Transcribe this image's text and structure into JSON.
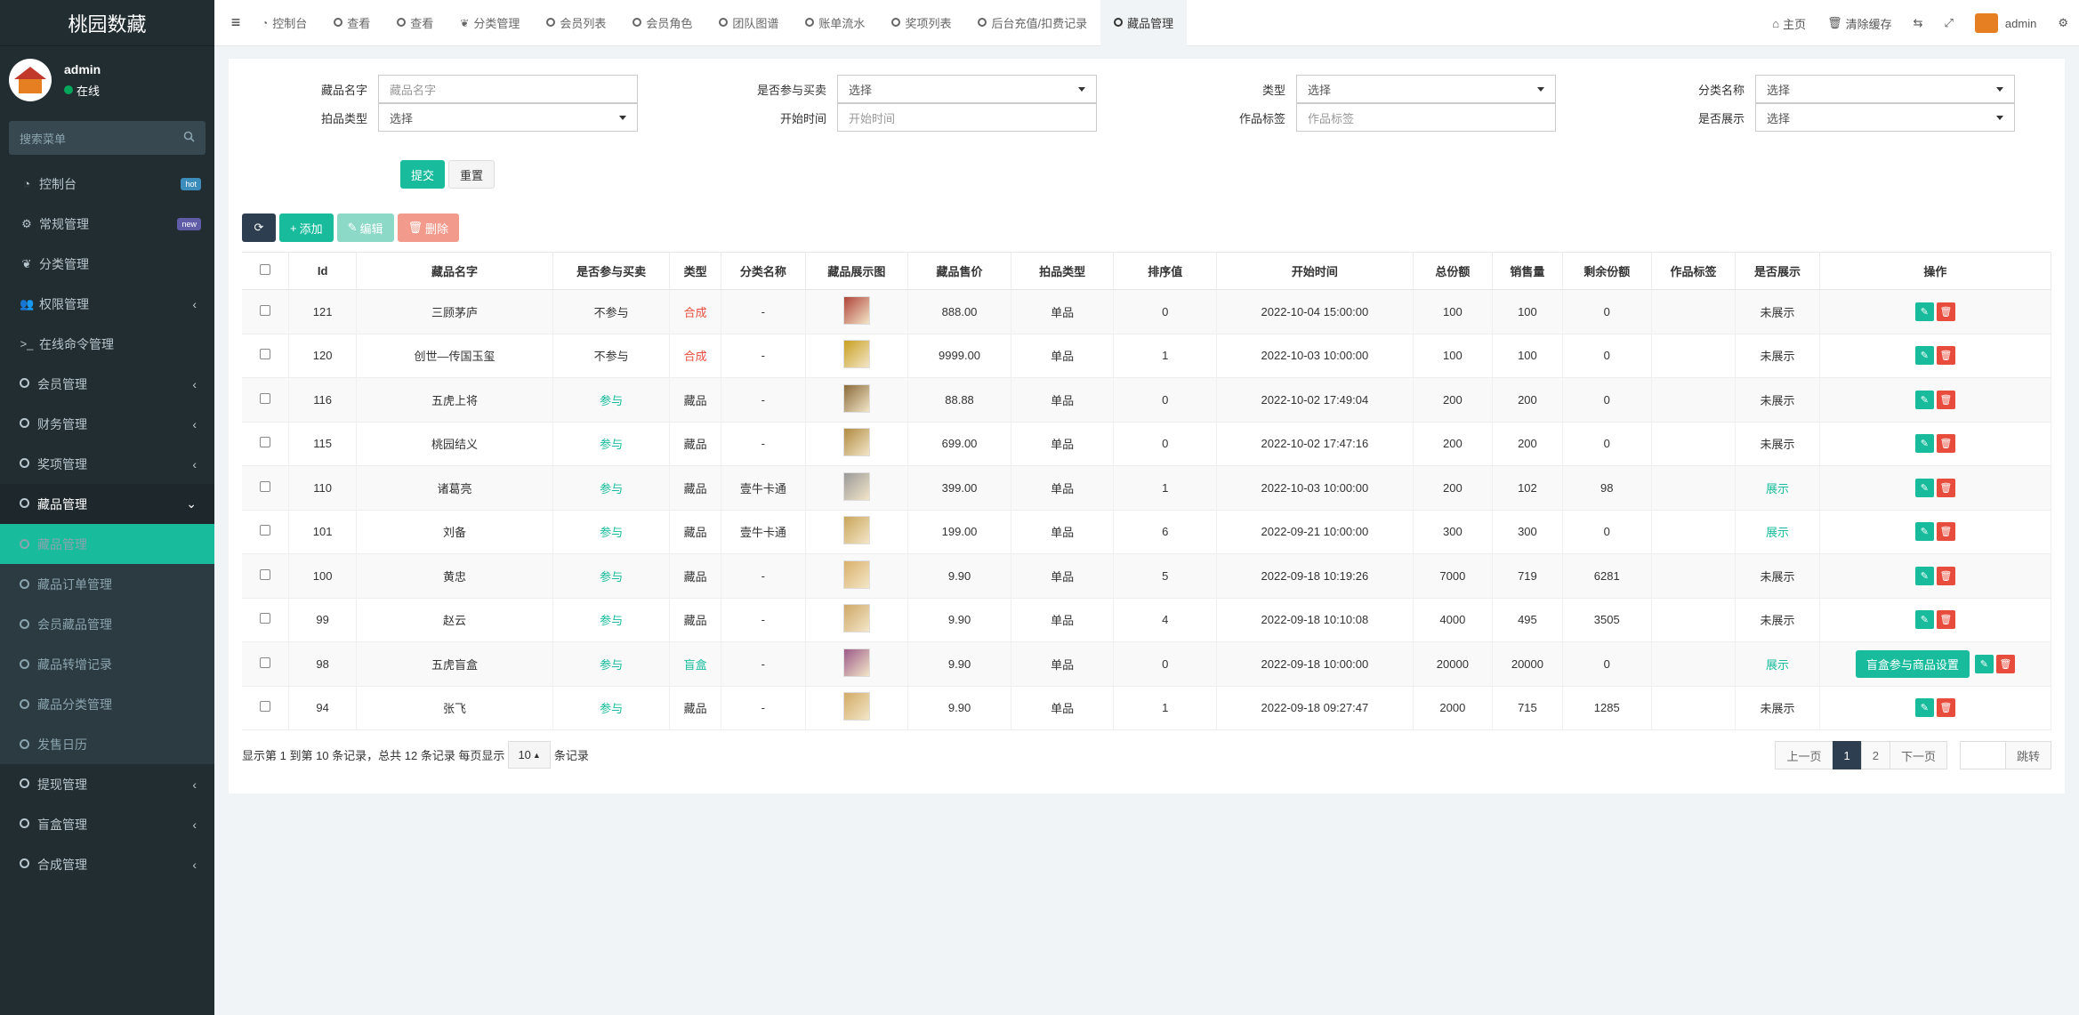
{
  "sidebar": {
    "brand": "桃园数藏",
    "user": {
      "name": "admin",
      "status": "在线"
    },
    "search_placeholder": "搜索菜单",
    "items": [
      {
        "label": "控制台",
        "icon": "dashboard-icon",
        "badge": "hot",
        "badge_color": "#3c8dbc"
      },
      {
        "label": "常规管理",
        "icon": "cogs-icon",
        "badge": "new",
        "badge_color": "#605ca8"
      },
      {
        "label": "分类管理",
        "icon": "leaf-icon"
      },
      {
        "label": "权限管理",
        "icon": "group-icon",
        "arrow": "‹"
      },
      {
        "label": "在线命令管理",
        "icon": "terminal-icon"
      },
      {
        "label": "会员管理",
        "icon": "circle-icon",
        "arrow": "‹"
      },
      {
        "label": "财务管理",
        "icon": "circle-icon",
        "arrow": "‹"
      },
      {
        "label": "奖项管理",
        "icon": "circle-icon",
        "arrow": "‹"
      },
      {
        "label": "藏品管理",
        "icon": "circle-icon",
        "arrow": "⌄"
      }
    ],
    "sub_items": [
      {
        "label": "藏品管理",
        "active": true
      },
      {
        "label": "藏品订单管理"
      },
      {
        "label": "会员藏品管理"
      },
      {
        "label": "藏品转增记录"
      },
      {
        "label": "藏品分类管理"
      },
      {
        "label": "发售日历"
      }
    ],
    "bottom_items": [
      {
        "label": "提现管理",
        "arrow": "‹"
      },
      {
        "label": "盲盒管理",
        "arrow": "‹"
      },
      {
        "label": "合成管理",
        "arrow": "‹"
      }
    ]
  },
  "tabs": [
    {
      "label": "控制台",
      "icon": "dashboard-icon"
    },
    {
      "label": "查看",
      "icon": "circle-icon"
    },
    {
      "label": "查看",
      "icon": "circle-icon"
    },
    {
      "label": "分类管理",
      "icon": "leaf-icon"
    },
    {
      "label": "会员列表",
      "icon": "circle-icon"
    },
    {
      "label": "会员角色",
      "icon": "circle-icon"
    },
    {
      "label": "团队图谱",
      "icon": "circle-icon"
    },
    {
      "label": "账单流水",
      "icon": "circle-icon"
    },
    {
      "label": "奖项列表",
      "icon": "circle-icon"
    },
    {
      "label": "后台充值/扣费记录",
      "icon": "circle-icon"
    },
    {
      "label": "藏品管理",
      "icon": "circle-icon",
      "active": true
    }
  ],
  "topright": {
    "home": "主页",
    "clear_cache": "清除缓存",
    "admin": "admin"
  },
  "form": {
    "row1": [
      {
        "label": "藏品名字",
        "placeholder": "藏品名字",
        "type": "input"
      },
      {
        "label": "是否参与买卖",
        "placeholder": "选择",
        "type": "select"
      },
      {
        "label": "类型",
        "placeholder": "选择",
        "type": "select"
      },
      {
        "label": "分类名称",
        "placeholder": "选择",
        "type": "select"
      }
    ],
    "row2": [
      {
        "label": "拍品类型",
        "placeholder": "选择",
        "type": "select"
      },
      {
        "label": "开始时间",
        "placeholder": "开始时间",
        "type": "input"
      },
      {
        "label": "作品标签",
        "placeholder": "作品标签",
        "type": "input"
      },
      {
        "label": "是否展示",
        "placeholder": "选择",
        "type": "select"
      }
    ],
    "submit": "提交",
    "reset": "重置"
  },
  "toolbar": {
    "add": "添加",
    "edit": "编辑",
    "delete": "删除"
  },
  "table": {
    "headers": [
      "Id",
      "藏品名字",
      "是否参与买卖",
      "类型",
      "分类名称",
      "藏品展示图",
      "藏品售价",
      "拍品类型",
      "排序值",
      "开始时间",
      "总份额",
      "销售量",
      "剩余份额",
      "作品标签",
      "是否展示",
      "操作"
    ],
    "rows": [
      {
        "id": "121",
        "name": "三顾茅庐",
        "trade": "不参与",
        "type": "合成",
        "cat": "-",
        "price": "888.00",
        "ptype": "单品",
        "sort": "0",
        "time": "2022-10-04 15:00:00",
        "total": "100",
        "sold": "100",
        "left": "0",
        "tag": "",
        "show": "未展示",
        "thumb": "#b0443a"
      },
      {
        "id": "120",
        "name": "创世—传国玉玺",
        "trade": "不参与",
        "type": "合成",
        "cat": "-",
        "price": "9999.00",
        "ptype": "单品",
        "sort": "1",
        "time": "2022-10-03 10:00:00",
        "total": "100",
        "sold": "100",
        "left": "0",
        "tag": "",
        "show": "未展示",
        "thumb": "#c8a020"
      },
      {
        "id": "116",
        "name": "五虎上将",
        "trade": "参与",
        "type": "藏品",
        "cat": "-",
        "price": "88.88",
        "ptype": "单品",
        "sort": "0",
        "time": "2022-10-02 17:49:04",
        "total": "200",
        "sold": "200",
        "left": "0",
        "tag": "",
        "show": "未展示",
        "thumb": "#8a6a3a"
      },
      {
        "id": "115",
        "name": "桃园结义",
        "trade": "参与",
        "type": "藏品",
        "cat": "-",
        "price": "699.00",
        "ptype": "单品",
        "sort": "0",
        "time": "2022-10-02 17:47:16",
        "total": "200",
        "sold": "200",
        "left": "0",
        "tag": "",
        "show": "未展示",
        "thumb": "#b08a40"
      },
      {
        "id": "110",
        "name": "诸葛亮",
        "trade": "参与",
        "type": "藏品",
        "cat": "壹牛卡通",
        "price": "399.00",
        "ptype": "单品",
        "sort": "1",
        "time": "2022-10-03 10:00:00",
        "total": "200",
        "sold": "102",
        "left": "98",
        "tag": "",
        "show": "展示",
        "thumb": "#9a9a9a"
      },
      {
        "id": "101",
        "name": "刘备",
        "trade": "参与",
        "type": "藏品",
        "cat": "壹牛卡通",
        "price": "199.00",
        "ptype": "单品",
        "sort": "6",
        "time": "2022-09-21 10:00:00",
        "total": "300",
        "sold": "300",
        "left": "0",
        "tag": "",
        "show": "展示",
        "thumb": "#c9a55a"
      },
      {
        "id": "100",
        "name": "黄忠",
        "trade": "参与",
        "type": "藏品",
        "cat": "-",
        "price": "9.90",
        "ptype": "单品",
        "sort": "5",
        "time": "2022-09-18 10:19:26",
        "total": "7000",
        "sold": "719",
        "left": "6281",
        "tag": "",
        "show": "未展示",
        "thumb": "#d9b06a"
      },
      {
        "id": "99",
        "name": "赵云",
        "trade": "参与",
        "type": "藏品",
        "cat": "-",
        "price": "9.90",
        "ptype": "单品",
        "sort": "4",
        "time": "2022-09-18 10:10:08",
        "total": "4000",
        "sold": "495",
        "left": "3505",
        "tag": "",
        "show": "未展示",
        "thumb": "#cfa868"
      },
      {
        "id": "98",
        "name": "五虎盲盒",
        "trade": "参与",
        "type": "盲盒",
        "cat": "-",
        "price": "9.90",
        "ptype": "单品",
        "sort": "0",
        "time": "2022-09-18 10:00:00",
        "total": "20000",
        "sold": "20000",
        "left": "0",
        "tag": "",
        "show": "展示",
        "thumb": "#9c5a8a",
        "extra_btn": "盲盒参与商品设置"
      },
      {
        "id": "94",
        "name": "张飞",
        "trade": "参与",
        "type": "藏品",
        "cat": "-",
        "price": "9.90",
        "ptype": "单品",
        "sort": "1",
        "time": "2022-09-18 09:27:47",
        "total": "2000",
        "sold": "715",
        "left": "1285",
        "tag": "",
        "show": "未展示",
        "thumb": "#d2ab66"
      }
    ]
  },
  "footer": {
    "info_prefix": "显示第 1 到第 10 条记录，总共 12 条记录 每页显示",
    "page_size": "10",
    "info_suffix": "条记录",
    "prev": "上一页",
    "pages": [
      "1",
      "2"
    ],
    "next": "下一页",
    "jump": "跳转"
  }
}
